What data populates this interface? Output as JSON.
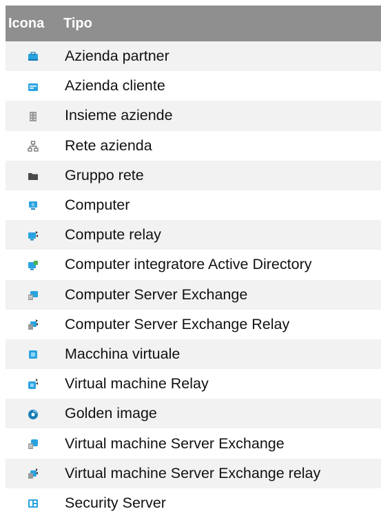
{
  "table": {
    "headers": {
      "icon": "Icona",
      "type": "Tipo"
    },
    "rows": [
      {
        "icon": "partner-company-icon",
        "label": "Azienda partner"
      },
      {
        "icon": "customer-company-icon",
        "label": "Azienda cliente"
      },
      {
        "icon": "companies-group-icon",
        "label": "Insieme aziende"
      },
      {
        "icon": "company-network-icon",
        "label": "Rete azienda"
      },
      {
        "icon": "network-group-folder-icon",
        "label": "Gruppo rete"
      },
      {
        "icon": "computer-icon",
        "label": "Computer"
      },
      {
        "icon": "computer-relay-icon",
        "label": "Compute relay"
      },
      {
        "icon": "active-directory-integrator-icon",
        "label": "Computer integratore Active Directory"
      },
      {
        "icon": "exchange-server-computer-icon",
        "label": "Computer Server Exchange"
      },
      {
        "icon": "exchange-server-relay-icon",
        "label": "Computer Server Exchange Relay"
      },
      {
        "icon": "virtual-machine-icon",
        "label": "Macchina virtuale"
      },
      {
        "icon": "virtual-machine-relay-icon",
        "label": "Virtual machine Relay"
      },
      {
        "icon": "golden-image-icon",
        "label": "Golden image"
      },
      {
        "icon": "virtual-machine-exchange-icon",
        "label": "Virtual machine Server Exchange"
      },
      {
        "icon": "virtual-machine-exchange-relay-icon",
        "label": "Virtual machine Server Exchange relay"
      },
      {
        "icon": "security-server-icon",
        "label": "Security Server"
      }
    ]
  }
}
